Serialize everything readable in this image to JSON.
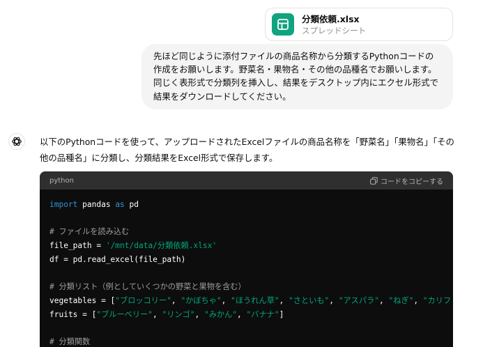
{
  "attachment": {
    "file_name": "分類依頼.xlsx",
    "file_type": "スプレッドシート"
  },
  "user_message": {
    "text": "先ほど同じように添付ファイルの商品名称から分類するPythonコードの作成をお願いします。野菜名・果物名・その他の品種名でお願いします。同じく表形式で分類列を挿入し、結果をデスクトップ内にエクセル形式で結果をダウンロードしてください。"
  },
  "assistant_message": {
    "intro_text": "以下のPythonコードを使って、アップロードされたExcelファイルの商品名称を「野菜名」「果物名」「その他の品種名」に分類し、分類結果をExcel形式で保存します。"
  },
  "code_block": {
    "language": "python",
    "copy_label": "コードをコピーする",
    "lines": [
      {
        "key": "l1",
        "tokens": [
          {
            "c": "kw",
            "t": "import"
          },
          {
            "c": "tx",
            "t": " pandas "
          },
          {
            "c": "kw",
            "t": "as"
          },
          {
            "c": "tx",
            "t": " pd"
          }
        ]
      },
      {
        "key": "l2",
        "tokens": []
      },
      {
        "key": "l3",
        "tokens": [
          {
            "c": "cm",
            "t": "# ファイルを読み込む"
          }
        ]
      },
      {
        "key": "l4",
        "tokens": [
          {
            "c": "tx",
            "t": "file_path = "
          },
          {
            "c": "str",
            "t": "'/mnt/data/分類依頼.xlsx'"
          }
        ]
      },
      {
        "key": "l5",
        "tokens": [
          {
            "c": "tx",
            "t": "df = pd.read_excel(file_path)"
          }
        ]
      },
      {
        "key": "l6",
        "tokens": []
      },
      {
        "key": "l7",
        "tokens": [
          {
            "c": "cm",
            "t": "# 分類リスト（例としていくつかの野菜と果物を含む）"
          }
        ]
      },
      {
        "key": "l8",
        "tokens": [
          {
            "c": "tx",
            "t": "vegetables = ["
          },
          {
            "c": "str",
            "t": "\"ブロッコリー\""
          },
          {
            "c": "tx",
            "t": ", "
          },
          {
            "c": "str",
            "t": "\"かぼちゃ\""
          },
          {
            "c": "tx",
            "t": ", "
          },
          {
            "c": "str",
            "t": "\"ほうれん草\""
          },
          {
            "c": "tx",
            "t": ", "
          },
          {
            "c": "str",
            "t": "\"さといも\""
          },
          {
            "c": "tx",
            "t": ", "
          },
          {
            "c": "str",
            "t": "\"アスパラ\""
          },
          {
            "c": "tx",
            "t": ", "
          },
          {
            "c": "str",
            "t": "\"ねぎ\""
          },
          {
            "c": "tx",
            "t": ", "
          },
          {
            "c": "str",
            "t": "\"カリフ"
          }
        ]
      },
      {
        "key": "l9",
        "tokens": [
          {
            "c": "tx",
            "t": "fruits = ["
          },
          {
            "c": "str",
            "t": "\"ブルーベリー\""
          },
          {
            "c": "tx",
            "t": ", "
          },
          {
            "c": "str",
            "t": "\"リンゴ\""
          },
          {
            "c": "tx",
            "t": ", "
          },
          {
            "c": "str",
            "t": "\"みかん\""
          },
          {
            "c": "tx",
            "t": ", "
          },
          {
            "c": "str",
            "t": "\"バナナ\""
          },
          {
            "c": "tx",
            "t": "]"
          }
        ]
      },
      {
        "key": "l10",
        "tokens": []
      },
      {
        "key": "l11",
        "tokens": [
          {
            "c": "cm",
            "t": "# 分類関数"
          }
        ]
      }
    ]
  },
  "colors": {
    "accent": "#10a37f",
    "code_keyword": "#2e95d3",
    "code_string": "#00a67d",
    "code_comment": "#9e9e9e"
  },
  "icons": {
    "file": "spreadsheet-icon",
    "assistant": "chatgpt-logo-icon",
    "copy": "copy-icon"
  }
}
